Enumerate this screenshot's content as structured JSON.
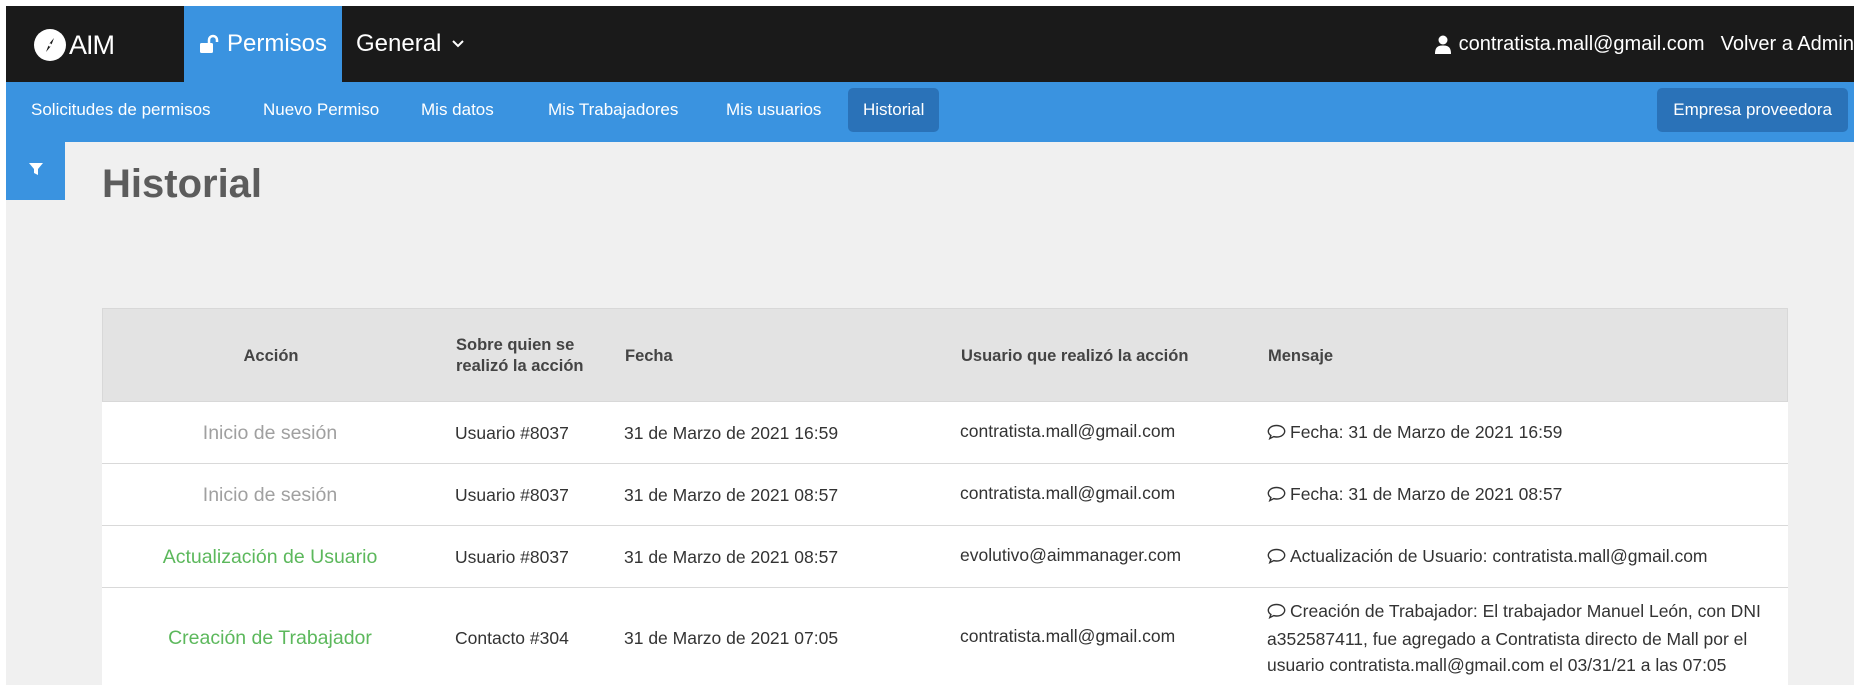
{
  "topbar": {
    "logo_text": "AIM",
    "nav_permisos": "Permisos",
    "nav_general": "General",
    "user_email": "contratista.mall@gmail.com",
    "volver": "Volver a Admin"
  },
  "subnav": {
    "items": [
      "Solicitudes de permisos",
      "Nuevo Permiso",
      "Mis datos",
      "Mis Trabajadores",
      "Mis usuarios",
      "Historial"
    ],
    "active": "Historial",
    "right": "Empresa proveedora"
  },
  "page": {
    "title": "Historial"
  },
  "table": {
    "headers": {
      "accion": "Acción",
      "sobre_line1": "Sobre quien se",
      "sobre_line2": "realizó la acción",
      "fecha": "Fecha",
      "usuario": "Usuario que realizó la acción",
      "mensaje": "Mensaje"
    },
    "rows": [
      {
        "accion": "Inicio de sesión",
        "sobre": "Usuario #8037",
        "fecha": "31 de Marzo de 2021 16:59",
        "usuario": "contratista.mall@gmail.com",
        "mensaje": "Fecha: 31 de Marzo de 2021 16:59"
      },
      {
        "accion": "Inicio de sesión",
        "sobre": "Usuario #8037",
        "fecha": "31 de Marzo de 2021 08:57",
        "usuario": "contratista.mall@gmail.com",
        "mensaje": "Fecha: 31 de Marzo de 2021 08:57"
      },
      {
        "accion": "Actualización de Usuario",
        "sobre": "Usuario #8037",
        "fecha": "31 de Marzo de 2021 08:57",
        "usuario": "evolutivo@aimmanager.com",
        "mensaje": "Actualización de Usuario: contratista.mall@gmail.com"
      },
      {
        "accion": "Creación de Trabajador",
        "sobre": "Contacto #304",
        "fecha": "31 de Marzo de 2021 07:05",
        "usuario": "contratista.mall@gmail.com",
        "mensaje_line1": "Creación de Trabajador: El trabajador Manuel León, con DNI",
        "mensaje_line2": "a352587411, fue agregado a Contratista directo de Mall por el",
        "mensaje_line3": "usuario contratista.mall@gmail.com el 03/31/21 a las 07:05"
      }
    ]
  },
  "colors": {
    "topbar": "#1a1a1a",
    "accent_blue": "#3a93e0",
    "active_blue": "#2a72b8",
    "action_gray": "#a0a0a0",
    "action_green": "#5cb85c"
  },
  "icons": [
    "compass-logo-icon",
    "unlock-icon",
    "chevron-down-icon",
    "user-icon",
    "filter-icon",
    "comment-icon"
  ]
}
